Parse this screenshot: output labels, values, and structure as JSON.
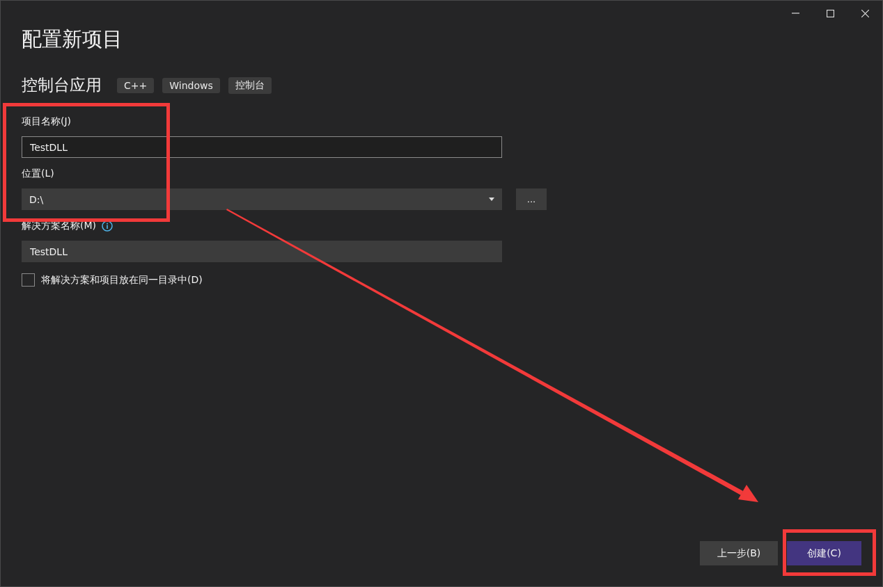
{
  "window": {
    "title": "配置新项目"
  },
  "template": {
    "name": "控制台应用",
    "tags": [
      "C++",
      "Windows",
      "控制台"
    ]
  },
  "fields": [
    {
      "kind": "text",
      "label": "项目名称(J)",
      "value": "TestDLL"
    },
    {
      "kind": "dropdown",
      "label": "位置(L)",
      "value": "D:\\",
      "browse": "..."
    },
    {
      "kind": "filled",
      "label": "解决方案名称(M)",
      "info": true,
      "value": "TestDLL"
    }
  ],
  "same_directory": {
    "label": "将解决方案和项目放在同一目录中(D)",
    "checked": false
  },
  "buttons": [
    {
      "label": "上一步(B)",
      "kind": "secondary"
    },
    {
      "label": "创建(C)",
      "kind": "primary"
    }
  ],
  "annotations": [
    {
      "kind": "box"
    },
    {
      "kind": "arrow"
    },
    {
      "kind": "box"
    }
  ]
}
